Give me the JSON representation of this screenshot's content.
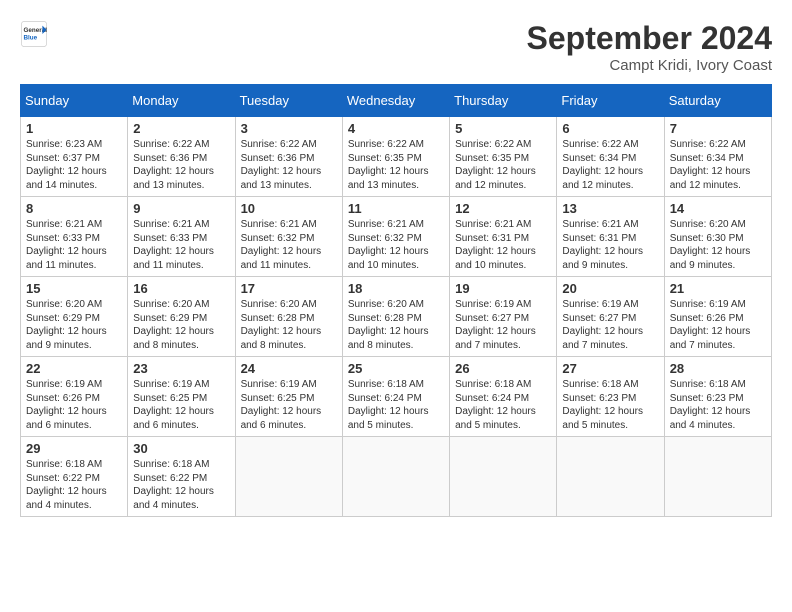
{
  "logo": {
    "general": "General",
    "blue": "Blue"
  },
  "title": "September 2024",
  "location": "Campt Kridi, Ivory Coast",
  "headers": [
    "Sunday",
    "Monday",
    "Tuesday",
    "Wednesday",
    "Thursday",
    "Friday",
    "Saturday"
  ],
  "weeks": [
    [
      {
        "day": "1",
        "sunrise": "6:23 AM",
        "sunset": "6:37 PM",
        "daylight": "12 hours and 14 minutes."
      },
      {
        "day": "2",
        "sunrise": "6:22 AM",
        "sunset": "6:36 PM",
        "daylight": "12 hours and 13 minutes."
      },
      {
        "day": "3",
        "sunrise": "6:22 AM",
        "sunset": "6:36 PM",
        "daylight": "12 hours and 13 minutes."
      },
      {
        "day": "4",
        "sunrise": "6:22 AM",
        "sunset": "6:35 PM",
        "daylight": "12 hours and 13 minutes."
      },
      {
        "day": "5",
        "sunrise": "6:22 AM",
        "sunset": "6:35 PM",
        "daylight": "12 hours and 12 minutes."
      },
      {
        "day": "6",
        "sunrise": "6:22 AM",
        "sunset": "6:34 PM",
        "daylight": "12 hours and 12 minutes."
      },
      {
        "day": "7",
        "sunrise": "6:22 AM",
        "sunset": "6:34 PM",
        "daylight": "12 hours and 12 minutes."
      }
    ],
    [
      {
        "day": "8",
        "sunrise": "6:21 AM",
        "sunset": "6:33 PM",
        "daylight": "12 hours and 11 minutes."
      },
      {
        "day": "9",
        "sunrise": "6:21 AM",
        "sunset": "6:33 PM",
        "daylight": "12 hours and 11 minutes."
      },
      {
        "day": "10",
        "sunrise": "6:21 AM",
        "sunset": "6:32 PM",
        "daylight": "12 hours and 11 minutes."
      },
      {
        "day": "11",
        "sunrise": "6:21 AM",
        "sunset": "6:32 PM",
        "daylight": "12 hours and 10 minutes."
      },
      {
        "day": "12",
        "sunrise": "6:21 AM",
        "sunset": "6:31 PM",
        "daylight": "12 hours and 10 minutes."
      },
      {
        "day": "13",
        "sunrise": "6:21 AM",
        "sunset": "6:31 PM",
        "daylight": "12 hours and 9 minutes."
      },
      {
        "day": "14",
        "sunrise": "6:20 AM",
        "sunset": "6:30 PM",
        "daylight": "12 hours and 9 minutes."
      }
    ],
    [
      {
        "day": "15",
        "sunrise": "6:20 AM",
        "sunset": "6:29 PM",
        "daylight": "12 hours and 9 minutes."
      },
      {
        "day": "16",
        "sunrise": "6:20 AM",
        "sunset": "6:29 PM",
        "daylight": "12 hours and 8 minutes."
      },
      {
        "day": "17",
        "sunrise": "6:20 AM",
        "sunset": "6:28 PM",
        "daylight": "12 hours and 8 minutes."
      },
      {
        "day": "18",
        "sunrise": "6:20 AM",
        "sunset": "6:28 PM",
        "daylight": "12 hours and 8 minutes."
      },
      {
        "day": "19",
        "sunrise": "6:19 AM",
        "sunset": "6:27 PM",
        "daylight": "12 hours and 7 minutes."
      },
      {
        "day": "20",
        "sunrise": "6:19 AM",
        "sunset": "6:27 PM",
        "daylight": "12 hours and 7 minutes."
      },
      {
        "day": "21",
        "sunrise": "6:19 AM",
        "sunset": "6:26 PM",
        "daylight": "12 hours and 7 minutes."
      }
    ],
    [
      {
        "day": "22",
        "sunrise": "6:19 AM",
        "sunset": "6:26 PM",
        "daylight": "12 hours and 6 minutes."
      },
      {
        "day": "23",
        "sunrise": "6:19 AM",
        "sunset": "6:25 PM",
        "daylight": "12 hours and 6 minutes."
      },
      {
        "day": "24",
        "sunrise": "6:19 AM",
        "sunset": "6:25 PM",
        "daylight": "12 hours and 6 minutes."
      },
      {
        "day": "25",
        "sunrise": "6:18 AM",
        "sunset": "6:24 PM",
        "daylight": "12 hours and 5 minutes."
      },
      {
        "day": "26",
        "sunrise": "6:18 AM",
        "sunset": "6:24 PM",
        "daylight": "12 hours and 5 minutes."
      },
      {
        "day": "27",
        "sunrise": "6:18 AM",
        "sunset": "6:23 PM",
        "daylight": "12 hours and 5 minutes."
      },
      {
        "day": "28",
        "sunrise": "6:18 AM",
        "sunset": "6:23 PM",
        "daylight": "12 hours and 4 minutes."
      }
    ],
    [
      {
        "day": "29",
        "sunrise": "6:18 AM",
        "sunset": "6:22 PM",
        "daylight": "12 hours and 4 minutes."
      },
      {
        "day": "30",
        "sunrise": "6:18 AM",
        "sunset": "6:22 PM",
        "daylight": "12 hours and 4 minutes."
      },
      null,
      null,
      null,
      null,
      null
    ]
  ]
}
